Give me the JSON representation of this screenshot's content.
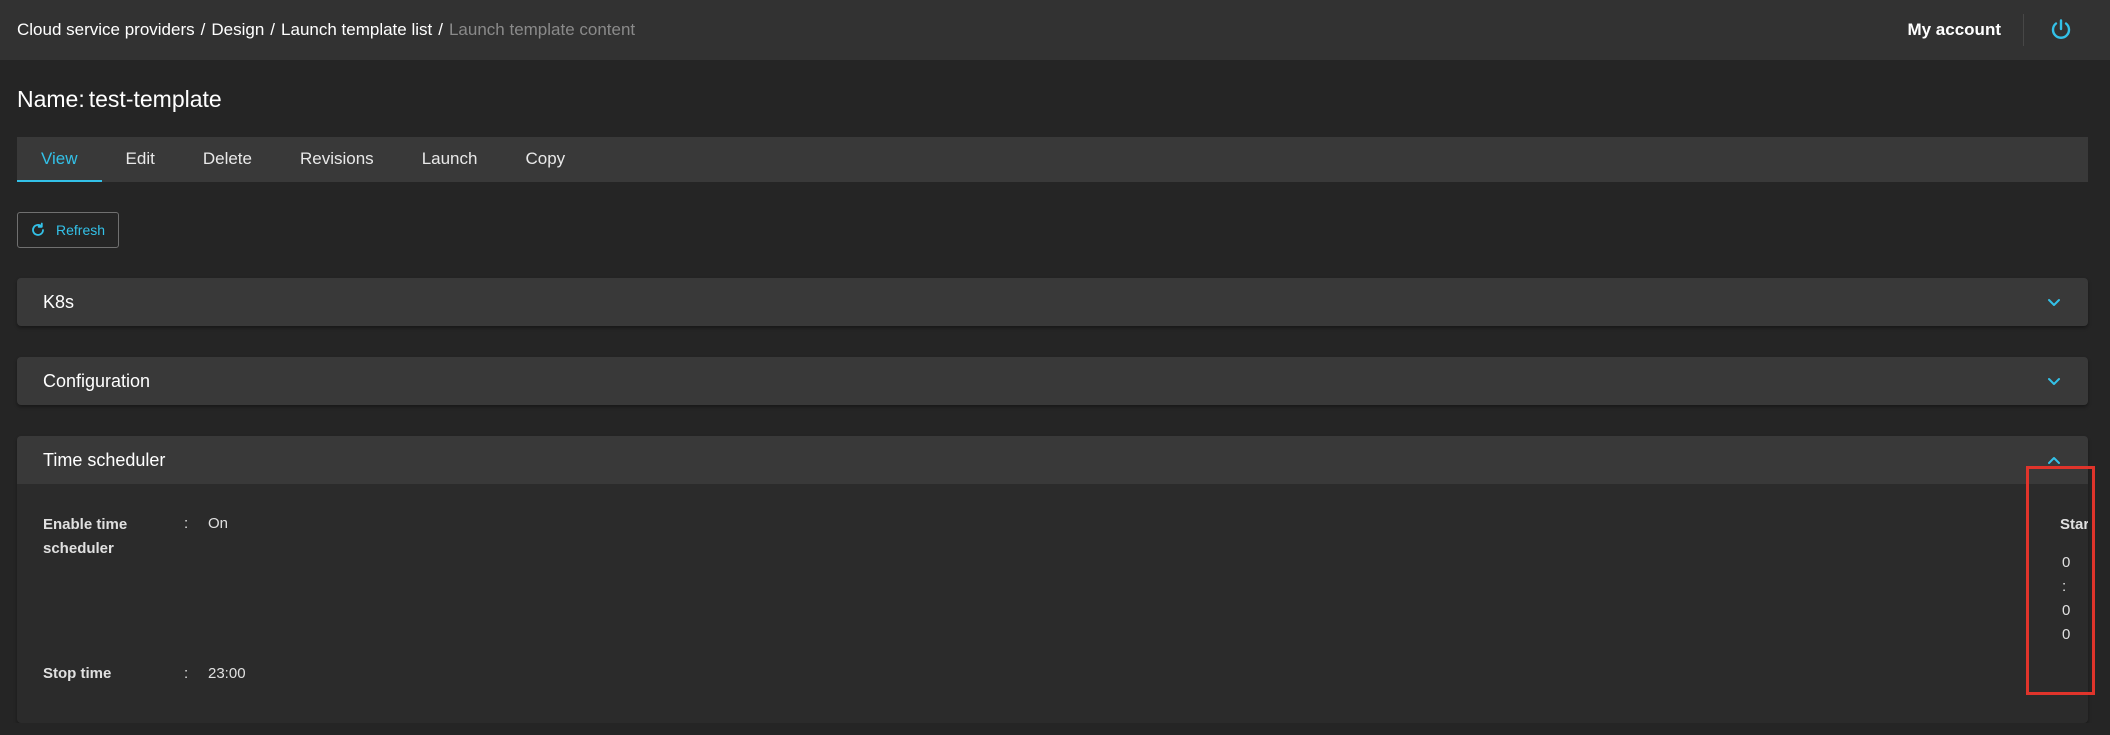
{
  "breadcrumb": {
    "items": [
      {
        "label": "Cloud service providers"
      },
      {
        "label": "Design"
      },
      {
        "label": "Launch template list"
      },
      {
        "label": "Launch template content"
      }
    ],
    "separator": "/"
  },
  "header": {
    "account_label": "My account",
    "power_icon": "power-icon",
    "accent_color": "#33c1e8"
  },
  "page": {
    "title_label": "Name:",
    "title_value": "test-template"
  },
  "tabs": [
    {
      "label": "View",
      "active": true
    },
    {
      "label": "Edit",
      "active": false
    },
    {
      "label": "Delete",
      "active": false
    },
    {
      "label": "Revisions",
      "active": false
    },
    {
      "label": "Launch",
      "active": false
    },
    {
      "label": "Copy",
      "active": false
    }
  ],
  "refresh_button": {
    "label": "Refresh",
    "icon": "refresh-icon"
  },
  "panels": {
    "k8s": {
      "title": "K8s",
      "expanded": false
    },
    "configuration": {
      "title": "Configuration",
      "expanded": false
    },
    "time_scheduler": {
      "title": "Time scheduler",
      "expanded": true,
      "enable_label_line1": "Enable time",
      "enable_label_line2": "scheduler",
      "enable_value": "On",
      "stop_label": "Stop time",
      "stop_value": "23:00",
      "colon": ":",
      "start_label": "Start time",
      "start_digits": [
        "0",
        ":",
        "0",
        "0"
      ]
    }
  },
  "highlight_color": "#e0342b"
}
